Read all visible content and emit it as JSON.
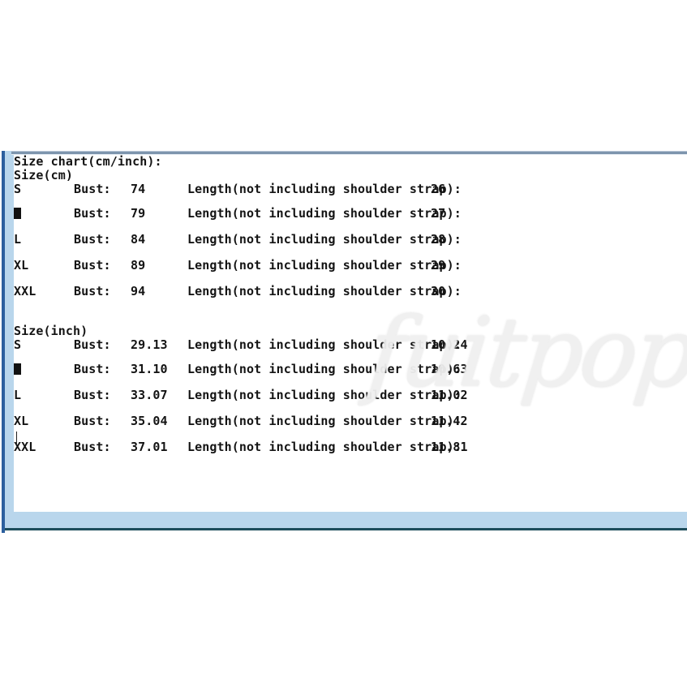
{
  "document": {
    "title_line": "Size chart(cm/inch):"
  },
  "watermark": {
    "text": "fuitpop",
    "color": "#f0f0f0"
  },
  "colors": {
    "panel_accent_dark_blue": "#2c5f9e",
    "panel_inner_light_blue": "#b9d6ec",
    "panel_top_rule": "#7d95ad",
    "panel_bottom_rule": "#1d4d5c",
    "text": "#141414",
    "page_background": "#ffffff"
  },
  "sections": [
    {
      "heading": "Size(cm)",
      "unit": "cm",
      "rows": [
        {
          "size": "S",
          "size_is_tofu": false,
          "bust_label": "Bust:",
          "bust_value": "74",
          "length_label": "Length(not including shoulder strap):",
          "length_value": "26"
        },
        {
          "size": "M",
          "size_is_tofu": true,
          "bust_label": "Bust:",
          "bust_value": "79",
          "length_label": "Length(not including shoulder strap):",
          "length_value": "27"
        },
        {
          "size": "L",
          "size_is_tofu": false,
          "bust_label": "Bust:",
          "bust_value": "84",
          "length_label": "Length(not including shoulder strap):",
          "length_value": "28"
        },
        {
          "size": "XL",
          "size_is_tofu": false,
          "bust_label": "Bust:",
          "bust_value": "89",
          "length_label": "Length(not including shoulder strap):",
          "length_value": "29"
        },
        {
          "size": "XXL",
          "size_is_tofu": false,
          "bust_label": "Bust:",
          "bust_value": "94",
          "length_label": "Length(not including shoulder strap):",
          "length_value": "30"
        }
      ]
    },
    {
      "heading": "Size(inch)",
      "unit": "inch",
      "rows": [
        {
          "size": "S",
          "size_is_tofu": false,
          "bust_label": "Bust:",
          "bust_value": "29.13",
          "length_label": "Length(not including shoulder strap):",
          "length_value": "10.24"
        },
        {
          "size": "M",
          "size_is_tofu": true,
          "bust_label": "Bust:",
          "bust_value": "31.10",
          "length_label": "Length(not including shoulder strap):",
          "length_value": "10.63"
        },
        {
          "size": "L",
          "size_is_tofu": false,
          "bust_label": "Bust:",
          "bust_value": "33.07",
          "length_label": "Length(not including shoulder strap):",
          "length_value": "11.02"
        },
        {
          "size": "XL",
          "size_is_tofu": false,
          "bust_label": "Bust:",
          "bust_value": "35.04",
          "length_label": "Length(not including shoulder strap):",
          "length_value": "11.42"
        },
        {
          "size": "XXL",
          "size_is_tofu": false,
          "bust_label": "Bust:",
          "bust_value": "37.01",
          "length_label": "Length(not including shoulder strap):",
          "length_value": "11.81"
        }
      ]
    }
  ]
}
